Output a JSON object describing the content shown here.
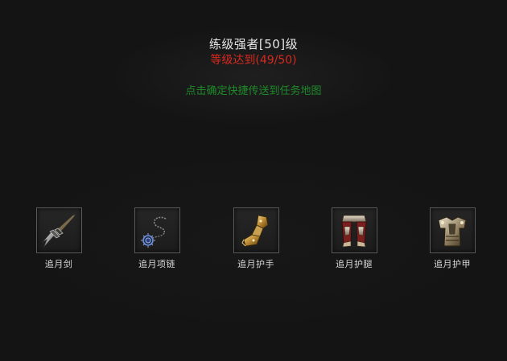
{
  "quest": {
    "title": "练级强者[50]级",
    "progress": "等级达到(49/50)",
    "hint": "点击确定快捷传送到任务地图"
  },
  "rewards": [
    {
      "name": "追月剑",
      "icon": "sword-icon"
    },
    {
      "name": "追月项链",
      "icon": "necklace-icon"
    },
    {
      "name": "追月护手",
      "icon": "gauntlet-icon"
    },
    {
      "name": "追月护腿",
      "icon": "leg-armor-icon"
    },
    {
      "name": "追月护甲",
      "icon": "chest-armor-icon"
    }
  ],
  "colors": {
    "background": "#141414",
    "title": "#e6e6e6",
    "progress": "#d62a20",
    "hint": "#1f8a2a",
    "slot_border": "#5a5a5a"
  }
}
